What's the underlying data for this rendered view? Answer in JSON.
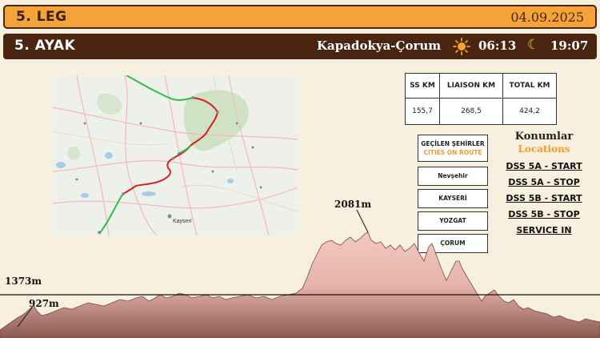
{
  "leg": {
    "title": "5. LEG",
    "date": "04.09.2025"
  },
  "ayak": {
    "title": "5. AYAK",
    "route": "Kapadokya-Çorum",
    "sunrise": "06:13",
    "sunset": "19:07",
    "sun_icon": "sun-icon",
    "moon_icon": "moon-icon"
  },
  "km": {
    "headers": [
      "SS KM",
      "LIAISON KM",
      "TOTAL KM"
    ],
    "values": [
      "155,7",
      "268,5",
      "424,2"
    ]
  },
  "cities": {
    "header_tr": "GEÇİLEN ŞEHİRLER",
    "header_en": "CITIES ON ROUTE",
    "items": [
      "Nevşehir",
      "KAYSERİ",
      "YOZGAT",
      "ÇORUM"
    ]
  },
  "locations": {
    "title_tr": "Konumlar",
    "title_en": "Locations",
    "links": [
      "DSS 5A - START",
      "DSS 5A - STOP",
      "DSS 5B - START",
      "DSS 5B - STOP",
      "SERVICE IN"
    ]
  },
  "elevation": {
    "max_label": "2081m",
    "ref_label": "1373m",
    "min_label": "927m"
  },
  "map": {
    "city_label": "Kayseri"
  },
  "colors": {
    "orange": "#f4a23a",
    "brown": "#4a2512",
    "stage_red": "#d42020",
    "liaison_green": "#2fbf3f"
  }
}
